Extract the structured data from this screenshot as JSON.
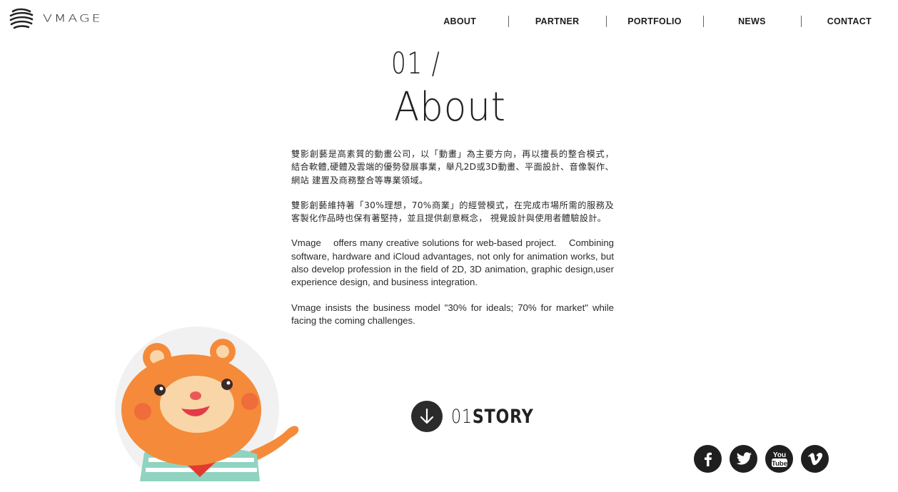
{
  "header": {
    "logo_text": "VMAGE",
    "nav": [
      {
        "label": "ABOUT"
      },
      {
        "label": "PARTNER"
      },
      {
        "label": "PORTFOLIO"
      },
      {
        "label": "NEWS"
      },
      {
        "label": "CONTACT"
      }
    ]
  },
  "section": {
    "number": "01 /",
    "title": "About"
  },
  "content": {
    "zh_para1": "雙影創藝是高素質的動畫公司，以「動畫」為主要方向，再以擅長的整合模式， 結合軟體,硬體及雲端的優勢發展事業，舉凡2D或3D動畫、平面設計、音像製作、網站 建置及商務整合等專業領域。",
    "zh_para2": "雙影創藝維持著「30%理想，70%商業」的經營模式，在完成市場所需的服務及客製化作品時也保有著堅持，並且提供創意概念， 視覺設計與使用者體驗設計。",
    "en_para1": "Vmage    offers many creative solutions for web-based project.    Combining software, hardware and iCloud advantages, not only for animation works, but also develop profession in the field of 2D, 3D animation, graphic design,user experience design, and business integration.",
    "en_para2": "Vmage insists the business model \"30% for ideals; 70% for market\" while facing the coming challenges."
  },
  "story": {
    "number": "01",
    "word": "STORY",
    "icon": "arrow-down-icon"
  },
  "social": [
    "facebook-icon",
    "twitter-icon",
    "youtube-icon",
    "vimeo-icon"
  ],
  "social_youtube_text": "You Tube",
  "colors": {
    "text": "#222222",
    "icon_bg": "#1f1f1f",
    "mascot_orange": "#f58a3a",
    "mascot_face": "#f9d6a8"
  }
}
